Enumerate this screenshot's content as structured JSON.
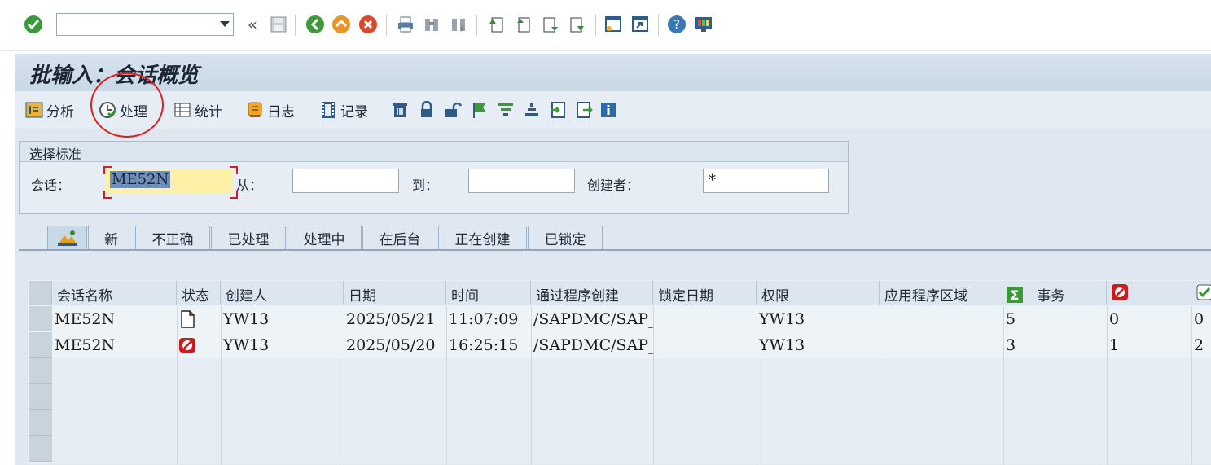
{
  "page_title": "批输入：会话概览",
  "command_field": {
    "value": ""
  },
  "app_toolbar": {
    "analyze": "分析",
    "process": "处理",
    "statistics": "统计",
    "log": "日志",
    "record": "记录"
  },
  "selection": {
    "title": "选择标准",
    "session_label": "会话：",
    "session_value": "ME52N",
    "from_label": "从：",
    "from_value": "",
    "to_label": "到：",
    "to_value": "",
    "creator_label": "创建者：",
    "creator_value": "*"
  },
  "tabs": [
    "新",
    "不正确",
    "已处理",
    "处理中",
    "在后台",
    "正在创建",
    "已锁定"
  ],
  "table": {
    "headers": {
      "session_name": "会话名称",
      "status": "状态",
      "creator": "创建人",
      "date": "日期",
      "time": "时间",
      "created_by_program": "通过程序创建",
      "lock_date": "锁定日期",
      "authorization": "权限",
      "app_area": "应用程序区域",
      "transactions": "事务"
    },
    "rows": [
      {
        "session_name": "ME52N",
        "status_icon": "new-document-icon",
        "creator": "YW13",
        "date": "2025/05/21",
        "time": "11:07:09",
        "program": "/SAPDMC/SAP_",
        "lock_date": "",
        "auth": "YW13",
        "app_area": "",
        "transactions": "5",
        "errors": "0",
        "processed": "0"
      },
      {
        "session_name": "ME52N",
        "status_icon": "error-icon",
        "creator": "YW13",
        "date": "2025/05/20",
        "time": "16:25:15",
        "program": "/SAPDMC/SAP_",
        "lock_date": "",
        "auth": "YW13",
        "app_area": "",
        "transactions": "3",
        "errors": "1",
        "processed": "2"
      }
    ]
  },
  "colors": {
    "accent_red": "#d02020",
    "highlight_yellow": "#fff0a8",
    "panel_blue": "#dfe8f0"
  }
}
